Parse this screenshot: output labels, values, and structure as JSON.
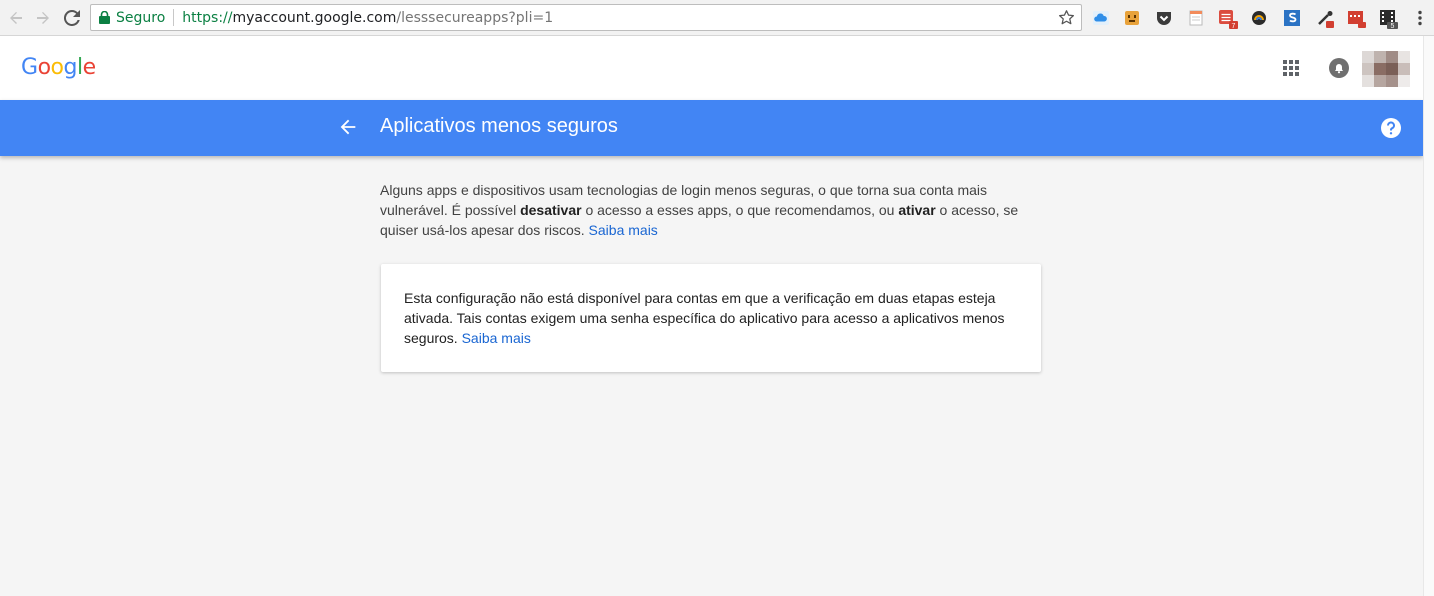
{
  "browser": {
    "secure_label": "Seguro",
    "url_scheme": "https://",
    "url_host": "myaccount.google.com",
    "url_path": "/lesssecureapps?pli=1",
    "extension_icons": [
      "cloud-icon",
      "face-icon",
      "pocket-icon",
      "notes-icon",
      "todoist-icon",
      "rainbow-icon",
      "s-icon",
      "eyedropper-icon",
      "calendar-icon",
      "film-icon",
      "menu-icon"
    ],
    "badge_todoist": "7",
    "badge_film": "5"
  },
  "header": {
    "logo_letters": [
      "G",
      "o",
      "o",
      "g",
      "l",
      "e"
    ],
    "logo_colors": [
      "#4285f4",
      "#ea4335",
      "#fbbc05",
      "#4285f4",
      "#34a853",
      "#ea4335"
    ]
  },
  "title_bar": {
    "title": "Aplicativos menos seguros",
    "color": "#4285f4"
  },
  "intro": {
    "part1": "Alguns apps e dispositivos usam tecnologias de login menos seguras, o que torna sua conta mais vulnerável. É possível ",
    "bold1": "desativar",
    "part2": " o acesso a esses apps, o que recomendamos, ou ",
    "bold2": "ativar",
    "part3": " o acesso, se quiser usá-los apesar dos riscos. ",
    "link": "Saiba mais"
  },
  "card": {
    "text": "Esta configuração não está disponível para contas em que a verificação em duas etapas esteja ativada. Tais contas exigem uma senha específica do aplicativo para acesso a aplicativos menos seguros. ",
    "link": "Saiba mais"
  }
}
